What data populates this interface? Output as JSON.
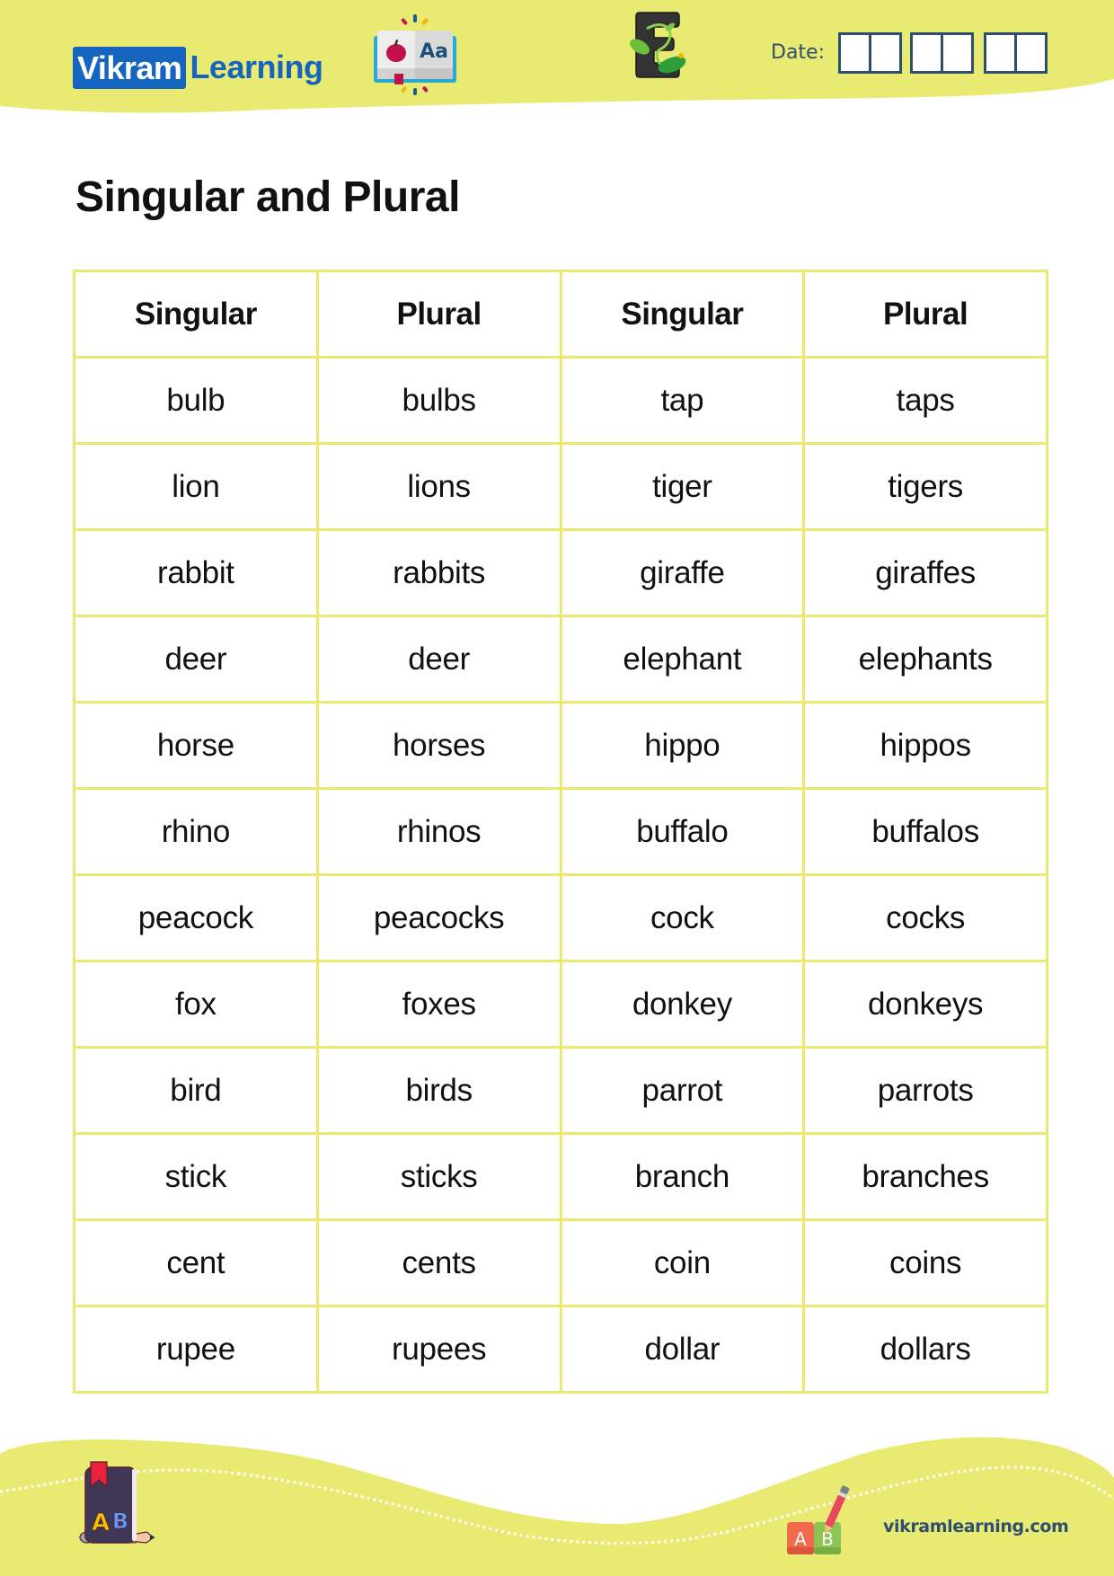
{
  "colors": {
    "accent_yellow": "#E8EA72",
    "brand_blue": "#1565C0",
    "navy": "#2F4F6F"
  },
  "header": {
    "logo": {
      "brand_box_text": "Vikram",
      "brand_rest_text": "Learning"
    },
    "icons": [
      "open-book-icon",
      "letter-e-leaf-icon"
    ],
    "date_label": "Date:",
    "date_groups": 3,
    "date_cells_per_group": 2
  },
  "title": "Singular and Plural",
  "table": {
    "headers": [
      "Singular",
      "Plural",
      "Singular",
      "Plural"
    ],
    "rows": [
      [
        "bulb",
        "bulbs",
        "tap",
        "taps"
      ],
      [
        "lion",
        "lions",
        "tiger",
        "tigers"
      ],
      [
        "rabbit",
        "rabbits",
        "giraffe",
        "giraffes"
      ],
      [
        "deer",
        "deer",
        "elephant",
        "elephants"
      ],
      [
        "horse",
        "horses",
        "hippo",
        "hippos"
      ],
      [
        "rhino",
        "rhinos",
        "buffalo",
        "buffalos"
      ],
      [
        "peacock",
        "peacocks",
        "cock",
        "cocks"
      ],
      [
        "fox",
        "foxes",
        "donkey",
        "donkeys"
      ],
      [
        "bird",
        "birds",
        "parrot",
        "parrots"
      ],
      [
        "stick",
        "sticks",
        "branch",
        "branches"
      ],
      [
        "cent",
        "cents",
        "coin",
        "coins"
      ],
      [
        "rupee",
        "rupees",
        "dollar",
        "dollars"
      ]
    ]
  },
  "footer": {
    "url_text": "vikramlearning.com",
    "icons": [
      "ab-book-icon",
      "ab-blocks-pencil-icon"
    ],
    "abc_letters": [
      "A",
      "B"
    ]
  }
}
